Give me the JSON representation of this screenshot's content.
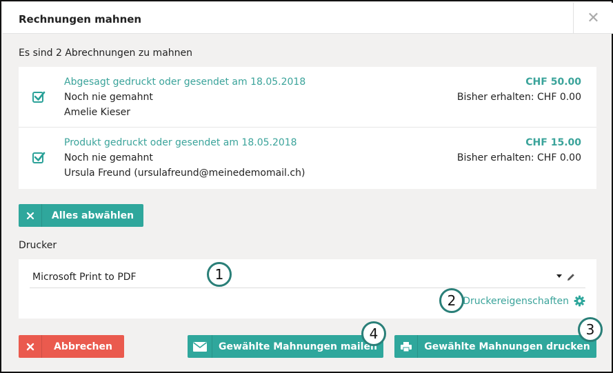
{
  "dialog": {
    "title": "Rechnungen mahnen",
    "close_glyph": "✕",
    "subtitle": "Es sind 2 Abrechnungen zu mahnen"
  },
  "items": [
    {
      "line1": "Abgesagt gedruckt oder gesendet am 18.05.2018",
      "line2": "Noch nie gemahnt",
      "line3": "Amelie Kieser",
      "amount": "CHF 50.00",
      "received": "Bisher erhalten: CHF 0.00",
      "checked": true
    },
    {
      "line1": "Produkt gedruckt oder gesendet am 18.05.2018",
      "line2": "Noch nie gemahnt",
      "line3": "Ursula Freund (ursulafreund@meinedemomail.ch)",
      "amount": "CHF 15.00",
      "received": "Bisher erhalten: CHF 0.00",
      "checked": true
    }
  ],
  "buttons": {
    "deselect_all": "Alles abwählen",
    "cancel": "Abbrechen",
    "mail": "Gewählte Mahnungen mailen",
    "print": "Gewählte Mahnungen drucken"
  },
  "printer": {
    "label": "Drucker",
    "selected": "Microsoft Print to PDF",
    "properties_link": "Druckereigenschaften"
  },
  "annotations": [
    "1",
    "2",
    "3",
    "4"
  ],
  "colors": {
    "accent": "#2fa79c",
    "danger": "#ea5a4e",
    "background": "#f2f1f0"
  }
}
